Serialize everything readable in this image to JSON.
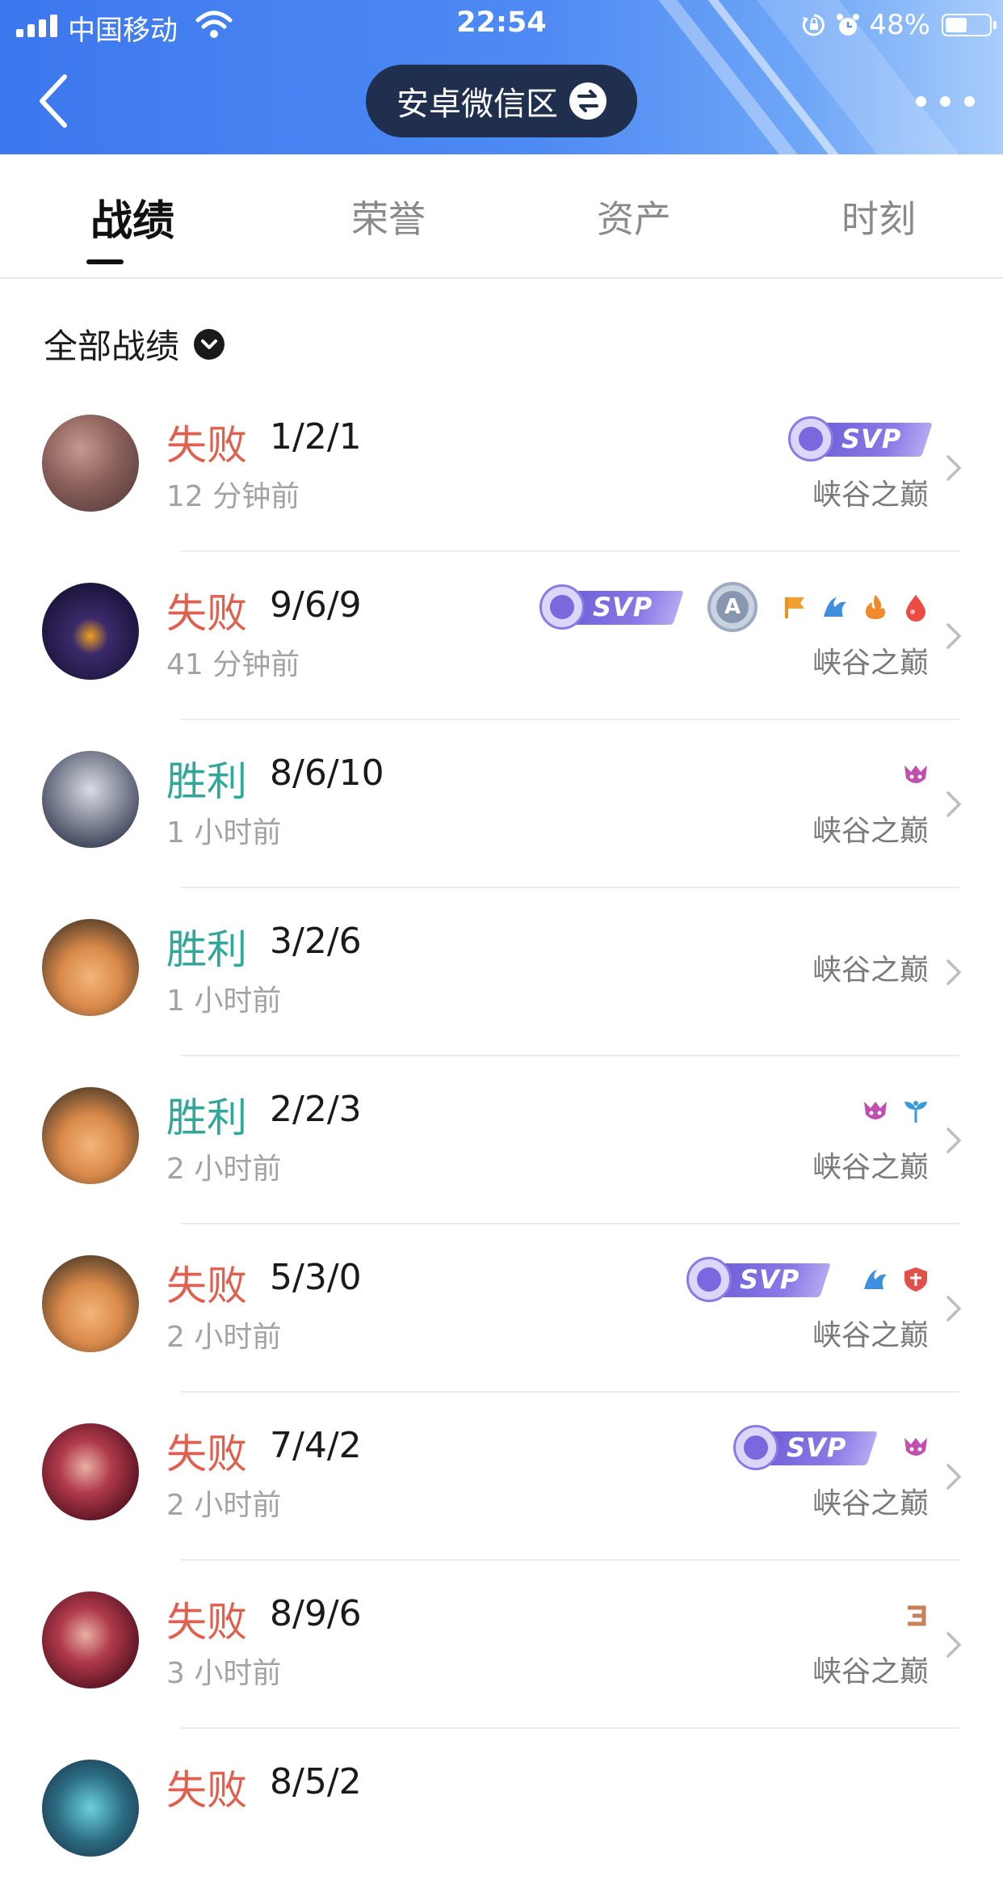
{
  "status_bar": {
    "carrier": "中国移动",
    "time": "22:54",
    "battery_pct": "48%",
    "icons": [
      "signal-icon",
      "wifi-icon",
      "rotation-lock-icon",
      "alarm-icon",
      "battery-icon"
    ]
  },
  "header": {
    "zone_label": "安卓微信区",
    "icons": [
      "back-icon",
      "swap-icon",
      "more-icon"
    ]
  },
  "tabs": [
    {
      "label": "战绩",
      "active": true
    },
    {
      "label": "荣誉",
      "active": false
    },
    {
      "label": "资产",
      "active": false
    },
    {
      "label": "时刻",
      "active": false
    }
  ],
  "filter": {
    "label": "全部战绩"
  },
  "records": [
    {
      "result": "失败",
      "kda": "1/2/1",
      "time": "12 分钟前",
      "mode": "峡谷之巅",
      "badges": [
        "svp-badge"
      ]
    },
    {
      "result": "失败",
      "kda": "9/6/9",
      "time": "41 分钟前",
      "mode": "峡谷之巅",
      "badges": [
        "svp-badge",
        "a-rank-medal",
        "flag-icon",
        "wave-icon",
        "fire-icon",
        "drop-icon"
      ]
    },
    {
      "result": "胜利",
      "kda": "8/6/10",
      "time": "1 小时前",
      "mode": "峡谷之巅",
      "badges": [
        "demon-icon"
      ]
    },
    {
      "result": "胜利",
      "kda": "3/2/6",
      "time": "1 小时前",
      "mode": "峡谷之巅",
      "badges": []
    },
    {
      "result": "胜利",
      "kda": "2/2/3",
      "time": "2 小时前",
      "mode": "峡谷之巅",
      "badges": [
        "demon-icon",
        "sprout-icon"
      ]
    },
    {
      "result": "失败",
      "kda": "5/3/0",
      "time": "2 小时前",
      "mode": "峡谷之巅",
      "badges": [
        "svp-badge",
        "wave-icon",
        "shield-icon"
      ]
    },
    {
      "result": "失败",
      "kda": "7/4/2",
      "time": "2 小时前",
      "mode": "峡谷之巅",
      "badges": [
        "svp-badge",
        "demon-icon"
      ]
    },
    {
      "result": "失败",
      "kda": "8/9/6",
      "time": "3 小时前",
      "mode": "峡谷之巅",
      "badges": [
        "triple-kill-icon"
      ]
    },
    {
      "result": "失败",
      "kda": "8/5/2",
      "time": "",
      "mode": "",
      "badges": []
    }
  ],
  "svp_text": "SVP",
  "a_text": "A",
  "colors": {
    "header_start": "#3c78ee",
    "header_end": "#a9cdfb",
    "zone_pill": "#1f2f4d",
    "lose": "#e0604f",
    "win": "#2fa89a",
    "svp": "#7b67de",
    "muted": "#a3a3a3"
  }
}
